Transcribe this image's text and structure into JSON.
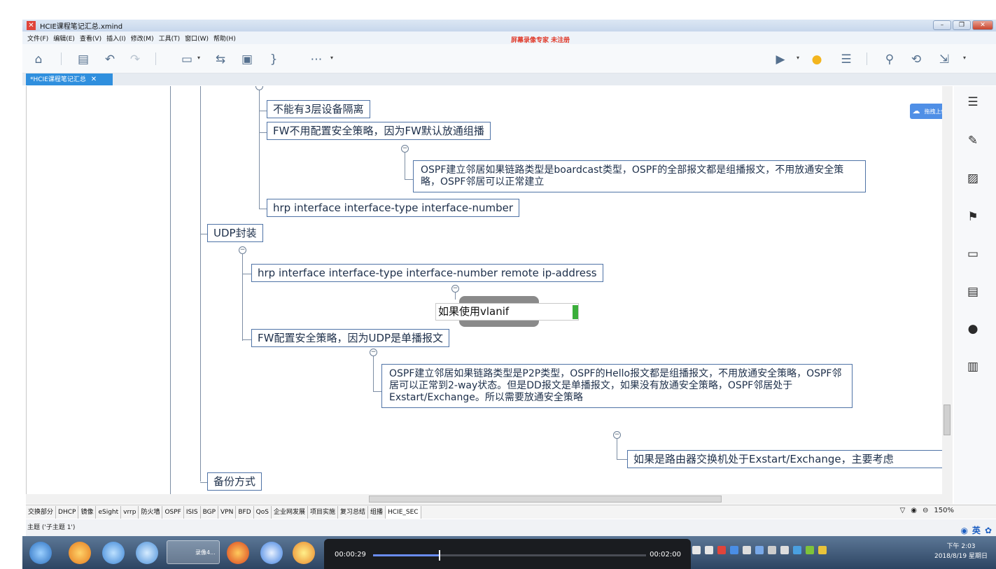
{
  "window": {
    "title": "HCIE课程笔记汇总.xmind",
    "controls": [
      "–",
      "❐",
      "✕"
    ]
  },
  "menu": {
    "items": [
      "文件(F)",
      "编辑(E)",
      "查看(V)",
      "插入(I)",
      "修改(M)",
      "工具(T)",
      "窗口(W)",
      "帮助(H)"
    ],
    "watermark": "屏幕录像专家 未注册"
  },
  "tab": {
    "label": "*HCIE课程笔记汇总",
    "close": "✕"
  },
  "mindmap": {
    "topics": [
      "不能有3层设备隔离",
      "FW不用配置安全策略，因为FW默认放通组播",
      "OSPF建立邻居如果链路类型是boardcast类型，OSPF的全部报文都是组播报文，不用放通安全策略，OSPF邻居可以正常建立",
      "hrp interface interface-type interface-number",
      "UDP封装",
      "hrp interface interface-type interface-number remote ip-address",
      "FW配置安全策略，因为UDP是单播报文",
      "OSPF建立邻居如果链路类型是P2P类型，OSPF的Hello报文都是组播报文，不用放通安全策略，OSPF邻居可以正常到2-way状态。但是DD报文是单播报文，如果没有放通安全策略，OSPF邻居处于Exstart/Exchange。所以需要放通安全策略",
      "如果是路由器交换机处于Exstart/Exchange，主要考虑",
      "备份方式"
    ],
    "editing_text": "如果使用vlanif"
  },
  "sidebar": {
    "upload_label": "拖拽上传"
  },
  "sheets": {
    "tabs": [
      "交换部分",
      "DHCP",
      "镜像",
      "eSight",
      "vrrp",
      "防火墙",
      "OSPF",
      "ISIS",
      "BGP",
      "VPN",
      "BFD",
      "QoS",
      "企业网发展",
      "项目实施",
      "复习总结",
      "组播",
      "HCIE_SEC"
    ],
    "active": "HCIE_SEC",
    "zoom": "150%"
  },
  "status": {
    "text": "主题 ('子主题 1')",
    "ime": "英"
  },
  "taskbar": {
    "active_label": "录像4...",
    "time": "下午 2:03",
    "date": "2018/8/19 星期日"
  },
  "video": {
    "current": "00:00:29",
    "total": "00:02:00",
    "progress": 0.24
  }
}
